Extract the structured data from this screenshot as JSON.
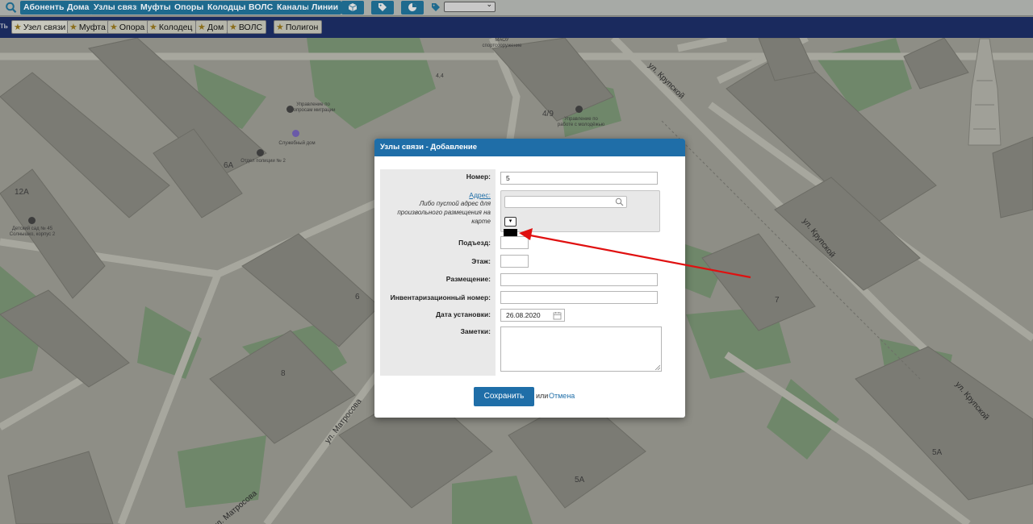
{
  "toolbar": {
    "buttons": [
      "Абоненты",
      "Дома",
      "Узлы связи",
      "Муфты",
      "Опоры",
      "Колодцы",
      "ВОЛС",
      "Каналы",
      "Линии"
    ],
    "icons": [
      "cube-icon",
      "tags-icon",
      "pie-chart-icon"
    ],
    "layer_select_value": ""
  },
  "object_bar": {
    "left_text": "ть",
    "items": [
      "Узел связи",
      "Муфта",
      "Опора",
      "Колодец",
      "Дом",
      "ВОЛС",
      "Полигон"
    ],
    "selected": "Узел связи"
  },
  "map": {
    "streets": [
      "ул. Крупской",
      "ул. Крупской",
      "ул. Крупской",
      "ул. Матросова",
      "ул. Матросова"
    ],
    "house_numbers": [
      "6А",
      "12А",
      "4/9",
      "6",
      "7",
      "8",
      "5А",
      "5А",
      "4,4"
    ],
    "pois": [
      "Управление по вопросам миграции",
      "Служебный дом",
      "Отдел полиции № 2",
      "Детский сад № 45 Солнышко, корпус 2",
      "Управление по работе с молодёжью",
      "МАОУ спортсооружение"
    ]
  },
  "dialog": {
    "title": "Узлы связи - Добавление",
    "labels": {
      "number": "Номер:",
      "address": "Адрес:",
      "address_hint": "Либо пустой адрес для произвольного размещения на карте",
      "entrance": "Подъезд:",
      "floor": "Этаж:",
      "placement": "Размещение:",
      "inventory": "Инвентаризационный номер:",
      "install_date": "Дата установки:",
      "notes": "Заметки:"
    },
    "values": {
      "number": "5",
      "address": "",
      "entrance": "",
      "floor": "",
      "placement": "",
      "inventory": "",
      "install_date": "26.08.2020",
      "notes": ""
    },
    "save_label": "Сохранить",
    "or_label": "или",
    "cancel_label": "Отмена"
  },
  "colors": {
    "accent": "#1f6ea8",
    "toolbar_button": "#1e6a8e",
    "object_bar": "#1a2a5e",
    "annotation_arrow": "#e01010"
  }
}
